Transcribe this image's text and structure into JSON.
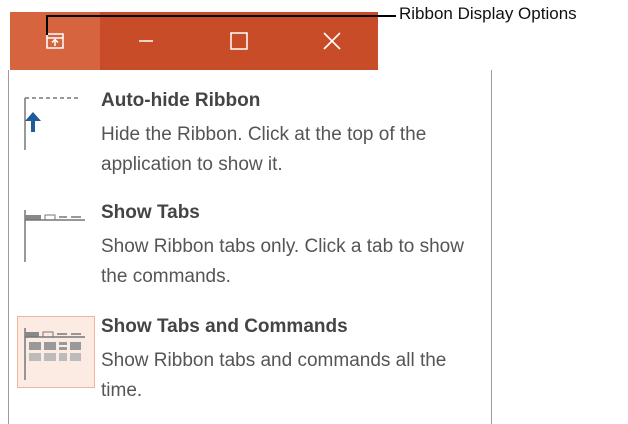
{
  "callout": {
    "label": "Ribbon Display Options"
  },
  "titlebar": {
    "buttons": [
      {
        "name": "ribbon-display-options",
        "icon": "ribbon-display-options-icon"
      },
      {
        "name": "minimize",
        "icon": "minimize-icon"
      },
      {
        "name": "maximize",
        "icon": "maximize-icon"
      },
      {
        "name": "close",
        "icon": "close-icon"
      }
    ],
    "colors": {
      "bar": "#c74c27",
      "active_button": "#d6643f"
    }
  },
  "menu": {
    "items": [
      {
        "title": "Auto-hide Ribbon",
        "description": "Hide the Ribbon. Click at the top of the application to show it.",
        "icon": "auto-hide-ribbon-icon"
      },
      {
        "title": "Show Tabs",
        "description": "Show Ribbon tabs only. Click a tab to show the commands.",
        "icon": "show-tabs-icon"
      },
      {
        "title": "Show Tabs and Commands",
        "description": "Show Ribbon tabs and commands all the time.",
        "icon": "show-tabs-and-commands-icon",
        "selected": true
      }
    ],
    "colors": {
      "accent": "#1e5d9a",
      "selected_bg": "#fcebe2",
      "selected_border": "#f1b79c"
    }
  }
}
